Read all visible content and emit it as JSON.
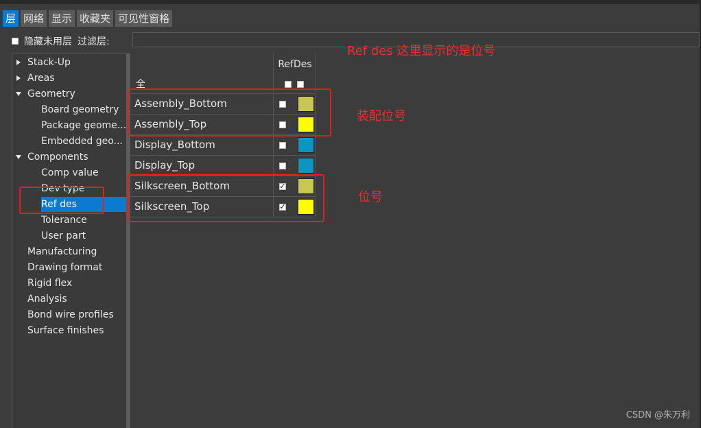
{
  "tabs": [
    {
      "label": "层",
      "active": true
    },
    {
      "label": "网络"
    },
    {
      "label": "显示"
    },
    {
      "label": "收藏夹"
    },
    {
      "label": "可见性窗格"
    }
  ],
  "filter": {
    "hide_unused_label": "隐藏未用层",
    "filter_label": "过滤层:",
    "filter_value": ""
  },
  "tree": [
    {
      "label": "Stack-Up",
      "expander": "collapsed"
    },
    {
      "label": "Areas",
      "expander": "collapsed"
    },
    {
      "label": "Geometry",
      "expander": "expanded"
    },
    {
      "label": "Board geometry"
    },
    {
      "label": "Package geome..."
    },
    {
      "label": "Embedded geo..."
    },
    {
      "label": "Components",
      "expander": "expanded"
    },
    {
      "label": "Comp value"
    },
    {
      "label": "Dev type"
    },
    {
      "label": "Ref des",
      "selected": true
    },
    {
      "label": "Tolerance"
    },
    {
      "label": "User part"
    },
    {
      "label": "Manufacturing"
    },
    {
      "label": "Drawing format"
    },
    {
      "label": "Rigid flex"
    },
    {
      "label": "Analysis"
    },
    {
      "label": "Bond wire profiles"
    },
    {
      "label": "Surface finishes"
    }
  ],
  "grid": {
    "column_title": "RefDes",
    "all_label": "全",
    "rows": [
      {
        "name": "Assembly_Bottom",
        "checked": false,
        "color": "#c8c850"
      },
      {
        "name": "Assembly_Top",
        "checked": false,
        "color": "#ffff00"
      },
      {
        "name": "Display_Bottom",
        "checked": false,
        "color": "#0a96c0"
      },
      {
        "name": "Display_Top",
        "checked": false,
        "color": "#0a96c0"
      },
      {
        "name": "Silkscreen_Bottom",
        "checked": true,
        "color": "#c8c850"
      },
      {
        "name": "Silkscreen_Top",
        "checked": true,
        "color": "#ffff00"
      }
    ]
  },
  "annotations": {
    "refdes_note": "Ref des 这里显示的是位号",
    "assembly_note": "装配位号",
    "silk_note": "位号"
  },
  "watermark": "CSDN @朱万利",
  "colors": {
    "accent": "#0a7bd0",
    "annotation": "#e02020"
  }
}
